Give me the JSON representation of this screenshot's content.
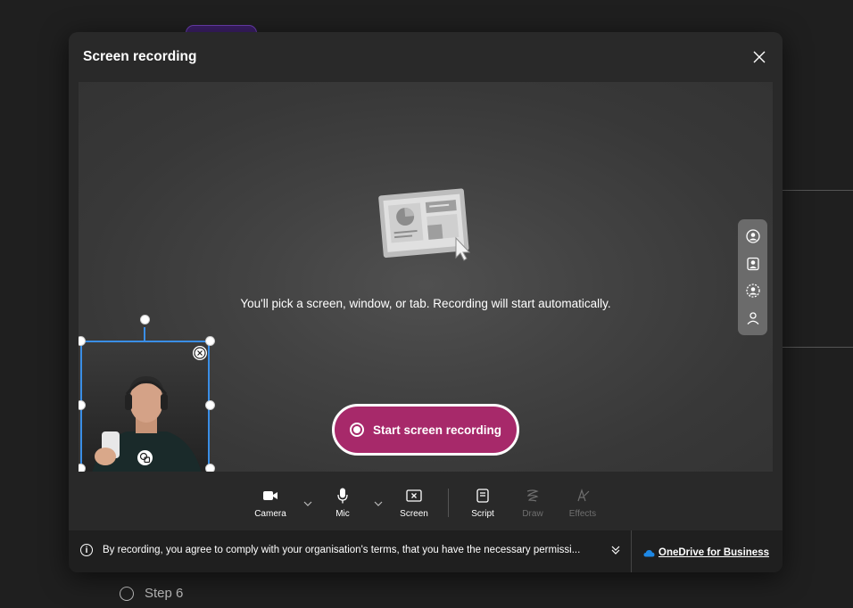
{
  "background": {
    "steps": [
      {
        "label": "Step 6"
      }
    ]
  },
  "dialog": {
    "title": "Screen recording",
    "hint": "You'll pick a screen, window, or tab. Recording will start automatically.",
    "start_button": "Start screen recording",
    "accent_color": "#a7296a",
    "selection_color": "#3a8ee6"
  },
  "side_panel": {
    "icons": [
      "camera-layout-circle-icon",
      "camera-layout-portrait-icon",
      "camera-layout-cutout-icon",
      "camera-layout-person-icon"
    ]
  },
  "toolbar": {
    "camera": "Camera",
    "mic": "Mic",
    "screen": "Screen",
    "script": "Script",
    "draw": "Draw",
    "effects": "Effects"
  },
  "footer": {
    "notice": "By recording, you agree to comply with your organisation's terms, that you have the necessary permissi...",
    "storage_link": "OneDrive for Business"
  }
}
